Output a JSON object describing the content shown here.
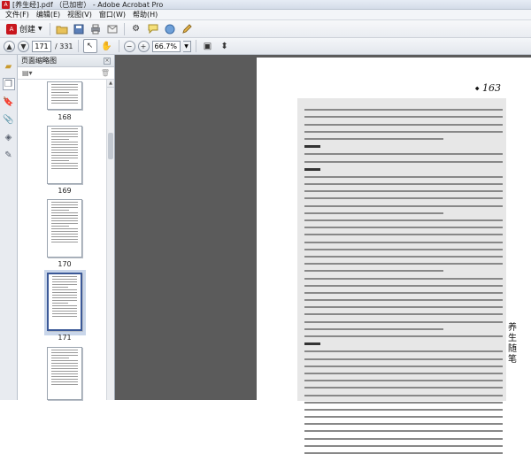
{
  "window": {
    "title": "[养生经].pdf （已加密） - Adobe Acrobat Pro"
  },
  "menu": {
    "items": [
      "文件(F)",
      "编辑(E)",
      "视图(V)",
      "窗口(W)",
      "帮助(H)"
    ]
  },
  "toolbar": {
    "create_label": "创建",
    "buttons": [
      "open-folder-icon",
      "save-icon",
      "print-icon",
      "email-icon",
      "settings-icon",
      "comment-icon",
      "share-icon",
      "edit-icon"
    ]
  },
  "navigation": {
    "current_page": "171",
    "total_pages": "/ 331",
    "zoom": "66.7%"
  },
  "thumbnails_panel": {
    "title": "页面缩略图",
    "pages": [
      {
        "number": "168",
        "selected": false
      },
      {
        "number": "169",
        "selected": false
      },
      {
        "number": "170",
        "selected": false
      },
      {
        "number": "171",
        "selected": true
      }
    ]
  },
  "document": {
    "page_number": "163",
    "side_title": [
      "养",
      "生",
      "随",
      "笔"
    ]
  },
  "colors": {
    "accent": "#3b5998",
    "doc_background": "#5b5b5b",
    "text_block": "#e7e7e7"
  }
}
